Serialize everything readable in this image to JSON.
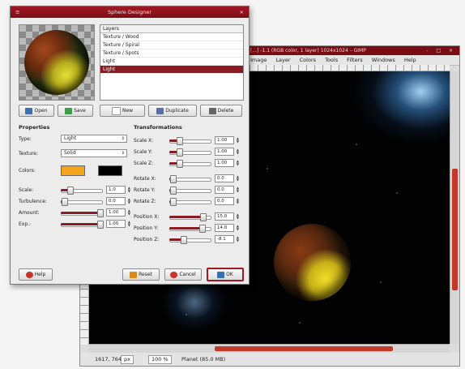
{
  "gimp": {
    "title": "[...] -1.1 (RGB color, 1 layer) 1024x1024 – GIMP",
    "window_buttons": "- □ ×",
    "menu": [
      "Image",
      "Layer",
      "Colors",
      "Tools",
      "Filters",
      "Windows",
      "Help"
    ],
    "status": {
      "coords": "1617, 764",
      "unit": "px",
      "zoom": "100 %",
      "message": "Planet (85.0 MB)"
    }
  },
  "dialog": {
    "title": "Sphere Designer",
    "close": "×",
    "menu_glyph": "≡",
    "layers": {
      "header": "Layers",
      "items": [
        "Texture / Wood",
        "Texture / Spiral",
        "Texture / Spots",
        "Light",
        "Light"
      ],
      "selected_index": 4
    },
    "buttons": {
      "open": "Open",
      "save": "Save",
      "new": "New",
      "duplicate": "Duplicate",
      "delete": "Delete",
      "help": "Help",
      "reset": "Reset",
      "cancel": "Cancel",
      "ok": "OK"
    },
    "properties": {
      "title": "Properties",
      "type_label": "Type:",
      "type_value": "Light",
      "texture_label": "Texture:",
      "texture_value": "Solid",
      "colors_label": "Colors:",
      "color1": "#f5a41c",
      "color2": "#000000",
      "scale_label": "Scale:",
      "scale_value": "1.0",
      "scale_fraction": 0.18,
      "turbulence_label": "Turbulence:",
      "turbulence_value": "0.0",
      "turbulence_fraction": 0.02,
      "amount_label": "Amount:",
      "amount_value": "1.00",
      "amount_fraction": 0.98,
      "exp_label": "Exp.:",
      "exp_value": "1.00",
      "exp_fraction": 0.98
    },
    "transformations": {
      "title": "Transformations",
      "rows": [
        {
          "label": "Scale X:",
          "value": "1.00",
          "fraction": 0.2
        },
        {
          "label": "Scale Y:",
          "value": "1.00",
          "fraction": 0.2
        },
        {
          "label": "Scale Z:",
          "value": "1.00",
          "fraction": 0.2
        },
        {
          "label": "Rotate X:",
          "value": "0.0",
          "fraction": 0.02
        },
        {
          "label": "Rotate Y:",
          "value": "0.0",
          "fraction": 0.02
        },
        {
          "label": "Rotate Z:",
          "value": "0.0",
          "fraction": 0.02
        },
        {
          "label": "Position X:",
          "value": "15.0",
          "fraction": 0.82
        },
        {
          "label": "Position Y:",
          "value": "14.0",
          "fraction": 0.8
        },
        {
          "label": "Position Z:",
          "value": "-8.1",
          "fraction": 0.3
        }
      ]
    }
  },
  "colors": {
    "accent": "#8a1b22",
    "title_bar": "#7a0c14"
  }
}
